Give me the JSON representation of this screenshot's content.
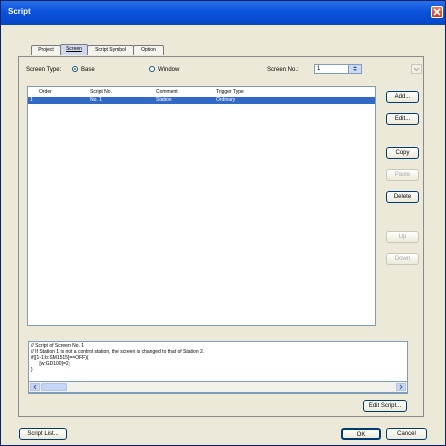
{
  "window": {
    "title": "Script"
  },
  "tabs": [
    {
      "label": "Project",
      "active": false
    },
    {
      "label": "Screen",
      "active": true
    },
    {
      "label": "Script Symbol",
      "active": false
    },
    {
      "label": "Option",
      "active": false
    }
  ],
  "screen_type": {
    "label": "Screen Type:",
    "options": [
      {
        "label": "Base",
        "checked": true
      },
      {
        "label": "Window",
        "checked": false
      }
    ]
  },
  "screen_no": {
    "label": "Screen No.:",
    "value": "1"
  },
  "list": {
    "columns": [
      "Order",
      "Script No.",
      "Comment",
      "Trigger Type"
    ],
    "rows": [
      {
        "order": "1",
        "script_no": "No. 1",
        "comment": "Station",
        "trigger": "Ordinary",
        "selected": true
      }
    ]
  },
  "buttons": {
    "add": "Add...",
    "edit": "Edit...",
    "copy": "Copy",
    "paste": "Paste",
    "delete": "Delete",
    "up": "Up",
    "down": "Down",
    "edit_script": "Edit Script...",
    "script_list": "Script List...",
    "ok": "OK",
    "cancel": "Cancel"
  },
  "script_preview": {
    "lines": [
      "// Script of Screen No. 1",
      "// If Station 1 is not a control station, the screen is changed to that of Station 2.",
      "if([1-1:b:SM1515]==OFF){",
      "      [w:GD100]=2;",
      "}"
    ]
  },
  "colors": {
    "title_bar": "#0a52dc",
    "selection": "#316ac5",
    "close_button": "#c8381c"
  }
}
